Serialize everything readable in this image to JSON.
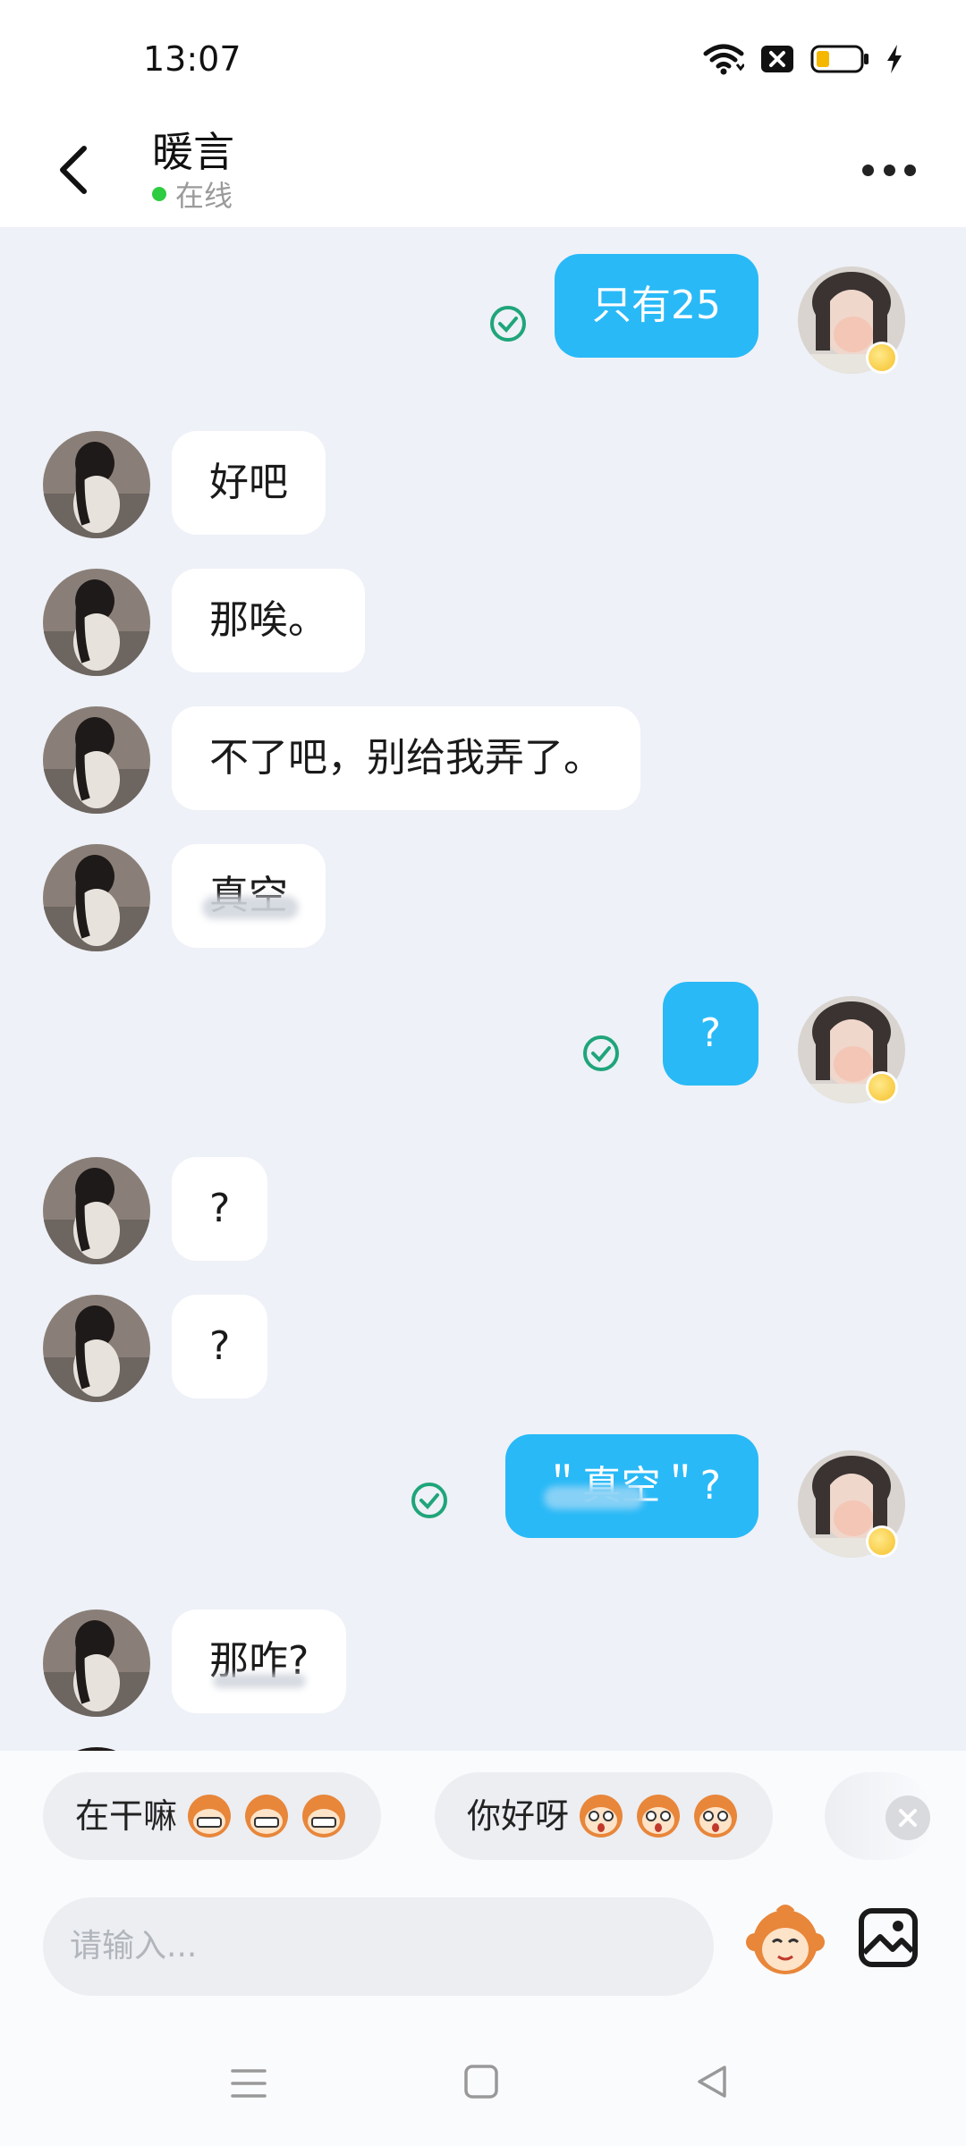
{
  "status_bar": {
    "time": "13:07"
  },
  "header": {
    "contact_name": "暖言",
    "online_status": "在线"
  },
  "messages": [
    {
      "sender": "self",
      "text": "只有25",
      "read": true
    },
    {
      "sender": "contact",
      "text": "好吧"
    },
    {
      "sender": "contact",
      "text": "那唉。"
    },
    {
      "sender": "contact",
      "text": "不了吧，别给我弄了。"
    },
    {
      "sender": "contact",
      "text": "真空"
    },
    {
      "sender": "self",
      "text": "?",
      "read": true
    },
    {
      "sender": "contact",
      "text": "?"
    },
    {
      "sender": "contact",
      "text": "?"
    },
    {
      "sender": "self",
      "text": "＂真空＂?",
      "read": true
    },
    {
      "sender": "contact",
      "text": "那咋?"
    }
  ],
  "quick_replies": [
    {
      "label": "在干嘛",
      "emoji": "grinning-monkey-icon"
    },
    {
      "label": "你好呀",
      "emoji": "surprised-monkey-icon"
    }
  ],
  "input": {
    "placeholder": "请输入..."
  },
  "colors": {
    "outgoing_bubble": "#29b9f7",
    "incoming_bubble": "#ffffff",
    "chat_background": "#eef1f7",
    "online_dot": "#2ecc40",
    "read_check": "#1fa57a"
  }
}
